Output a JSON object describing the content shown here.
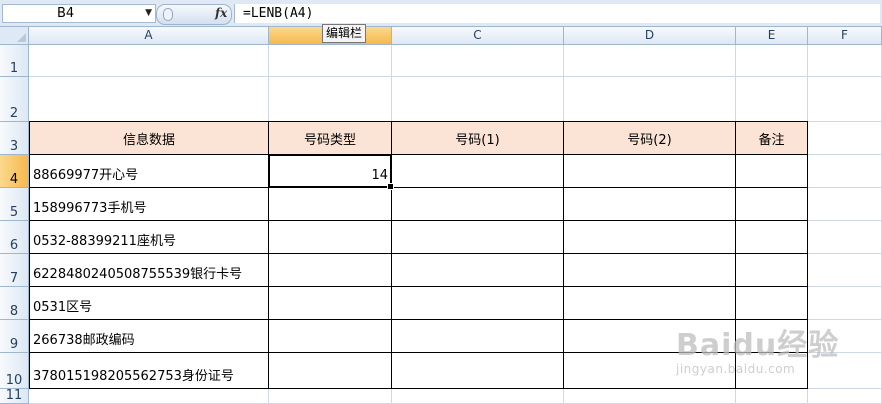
{
  "formula_bar": {
    "name_box": "B4",
    "fx_label": "fx",
    "formula": "=LENB(A4)",
    "tooltip": "编辑栏"
  },
  "columns": [
    "A",
    "B",
    "C",
    "D",
    "E",
    "F"
  ],
  "selected_column": "B",
  "rows": [
    "1",
    "2",
    "3",
    "4",
    "5",
    "6",
    "7",
    "8",
    "9",
    "10",
    "11"
  ],
  "selected_row": "4",
  "table": {
    "headers": [
      "信息数据",
      "号码类型",
      "号码(1)",
      "号码(2)",
      "备注"
    ],
    "data": [
      [
        "88669977开心号",
        "14",
        "",
        "",
        ""
      ],
      [
        "158996773手机号",
        "",
        "",
        "",
        ""
      ],
      [
        "0532-88399211座机号",
        "",
        "",
        "",
        ""
      ],
      [
        "6228480240508755539银行卡号",
        "",
        "",
        "",
        ""
      ],
      [
        "0531区号",
        "",
        "",
        "",
        ""
      ],
      [
        "266738邮政编码",
        "",
        "",
        "",
        ""
      ],
      [
        "378015198205562753身份证号",
        "",
        "",
        "",
        ""
      ]
    ]
  },
  "watermark": {
    "brand": "Baidu经验",
    "url": "jingyan.baidu.com"
  }
}
